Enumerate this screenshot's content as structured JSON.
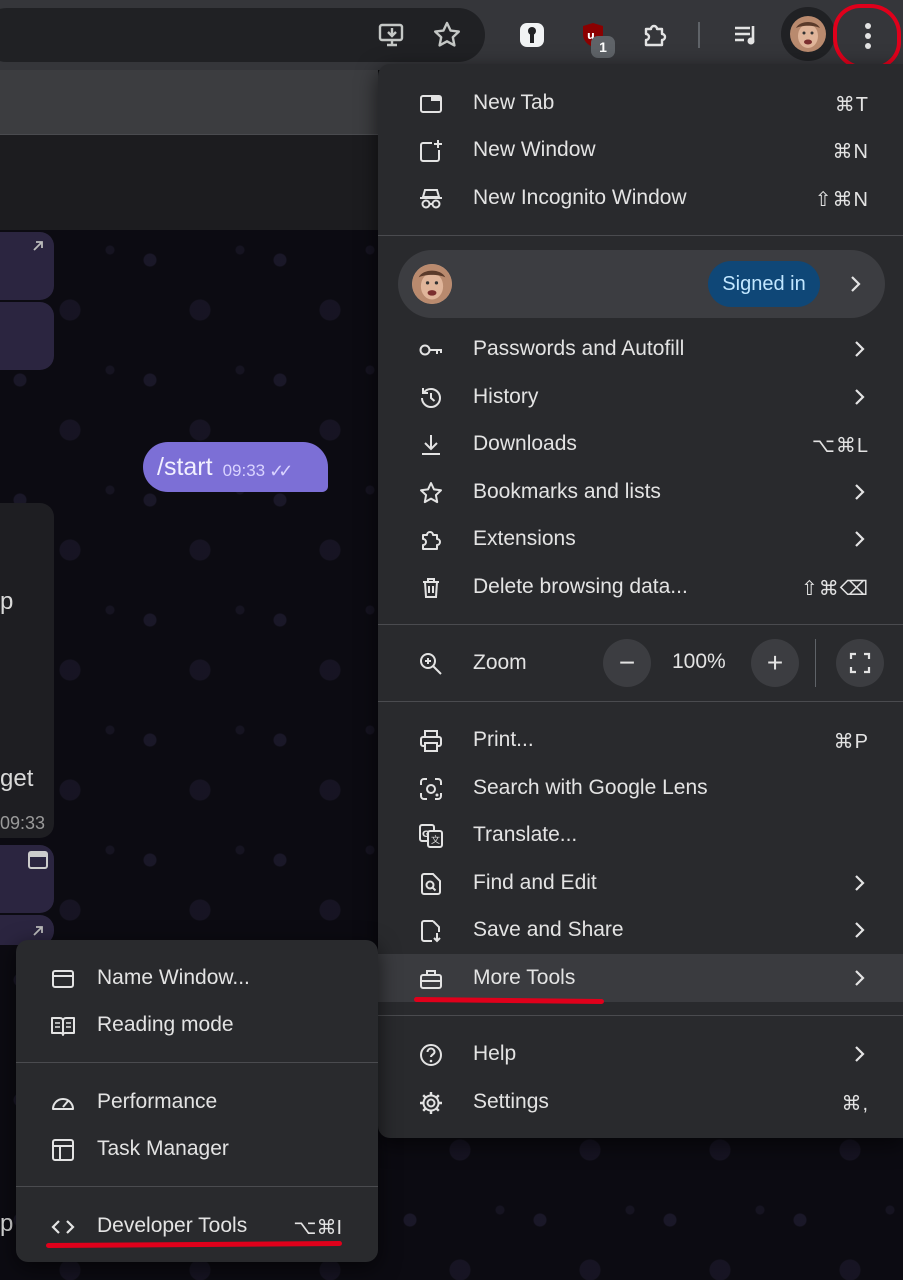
{
  "toolbar": {
    "extension_badge": "1",
    "icons": [
      "install-app-icon",
      "star-icon",
      "password-manager-icon",
      "ublock-icon",
      "extensions-puzzle-icon",
      "media-queue-icon",
      "profile-avatar",
      "kebab-menu-icon"
    ]
  },
  "chat": {
    "message_text": "/start",
    "message_time": "09:33",
    "side_text_1": "p",
    "side_text_2": "get",
    "side_time": "09:33",
    "side_text_3": "p"
  },
  "main_menu": {
    "new_tab": {
      "label": "New Tab",
      "shortcut": "⌘T"
    },
    "new_window": {
      "label": "New Window",
      "shortcut": "⌘N"
    },
    "new_incognito": {
      "label": "New Incognito Window",
      "shortcut": "⇧⌘N"
    },
    "profile": {
      "status": "Signed in"
    },
    "passwords": {
      "label": "Passwords and Autofill"
    },
    "history": {
      "label": "History"
    },
    "downloads": {
      "label": "Downloads",
      "shortcut": "⌥⌘L"
    },
    "bookmarks": {
      "label": "Bookmarks and lists"
    },
    "extensions": {
      "label": "Extensions"
    },
    "delete_data": {
      "label": "Delete browsing data...",
      "shortcut": "⇧⌘⌫"
    },
    "zoom": {
      "label": "Zoom",
      "minus": "−",
      "value": "100%",
      "plus": "+"
    },
    "print": {
      "label": "Print...",
      "shortcut": "⌘P"
    },
    "lens": {
      "label": "Search with Google Lens"
    },
    "translate": {
      "label": "Translate..."
    },
    "find_edit": {
      "label": "Find and Edit"
    },
    "save_share": {
      "label": "Save and Share"
    },
    "more_tools": {
      "label": "More Tools"
    },
    "help": {
      "label": "Help"
    },
    "settings": {
      "label": "Settings",
      "shortcut": "⌘,"
    }
  },
  "more_tools_menu": {
    "name_window": {
      "label": "Name Window..."
    },
    "reading_mode": {
      "label": "Reading mode"
    },
    "performance": {
      "label": "Performance"
    },
    "task_manager": {
      "label": "Task Manager"
    },
    "dev_tools": {
      "label": "Developer Tools",
      "shortcut": "⌥⌘I"
    }
  },
  "colors": {
    "menu_bg": "#292a2d",
    "highlight": "#3a3b3f",
    "annotation_red": "#e0001b",
    "signed_in_chip": "#0f4777",
    "message_bubble": "#7c6fd6"
  }
}
